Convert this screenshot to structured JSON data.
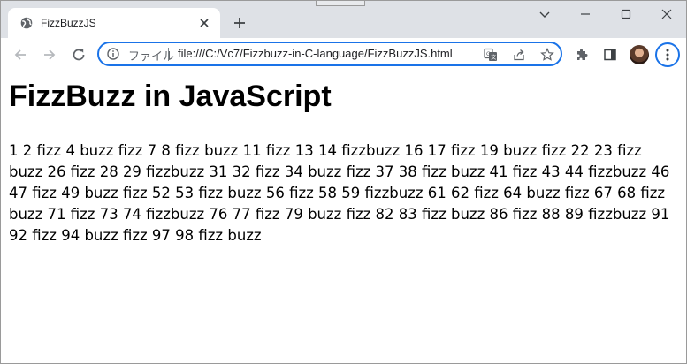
{
  "browser": {
    "tab": {
      "title": "FizzBuzzJS",
      "favicon": "globe-icon",
      "close_icon": "close-icon"
    },
    "new_tab_icon": "plus-icon",
    "window_controls": [
      "chevron-down-icon",
      "minimize-icon",
      "maximize-icon",
      "close-icon"
    ],
    "toolbar": {
      "nav_icons": [
        "back-arrow-icon",
        "forward-arrow-icon",
        "reload-icon"
      ],
      "omnibox": {
        "info_icon": "info-icon",
        "scheme_label": "ファイル",
        "url": "file:///C:/Vc7/Fizzbuzz-in-C-language/FizzBuzzJS.html",
        "icons": [
          "translate-icon",
          "share-icon",
          "bookmark-star-icon"
        ]
      },
      "right_icons": [
        "extensions-puzzle-icon",
        "side-panel-icon",
        "avatar",
        "kebab-menu-icon"
      ]
    },
    "accent_color": "#1a73e8"
  },
  "page": {
    "heading": "FizzBuzz in JavaScript",
    "output": "1 2 fizz 4 buzz fizz 7 8 fizz buzz 11 fizz 13 14 fizzbuzz 16 17 fizz 19 buzz fizz 22 23 fizz buzz 26 fizz 28 29 fizzbuzz 31 32 fizz 34 buzz fizz 37 38 fizz buzz 41 fizz 43 44 fizzbuzz 46 47 fizz 49 buzz fizz 52 53 fizz buzz 56 fizz 58 59 fizzbuzz 61 62 fizz 64 buzz fizz 67 68 fizz buzz 71 fizz 73 74 fizzbuzz 76 77 fizz 79 buzz fizz 82 83 fizz buzz 86 fizz 88 89 fizzbuzz 91 92 fizz 94 buzz fizz 97 98 fizz buzz"
  }
}
